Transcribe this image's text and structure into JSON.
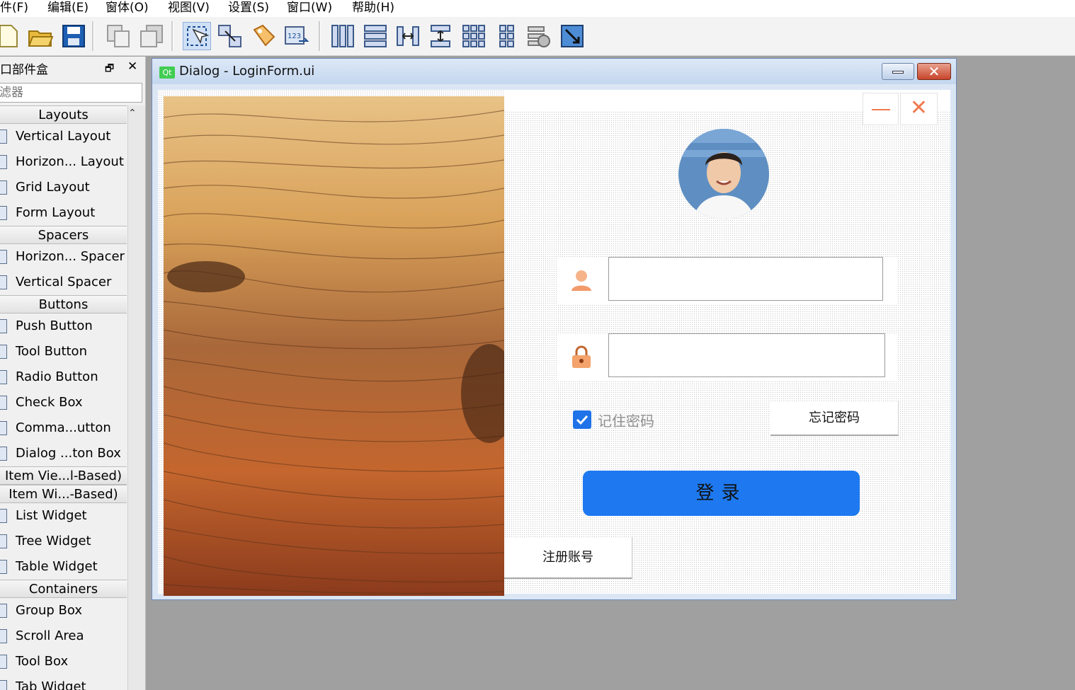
{
  "menu": [
    "件(F)",
    "编辑(E)",
    "窗体(O)",
    "视图(V)",
    "设置(S)",
    "窗口(W)",
    "帮助(H)"
  ],
  "toolbar_icons": [
    "new-file-icon",
    "open-folder-icon",
    "save-icon",
    "copy-icon",
    "paste-icon",
    "edit-widgets-icon",
    "edit-signals-slots-icon",
    "edit-buddies-icon",
    "edit-tab-order-icon",
    "layout-horizontal-icon",
    "layout-vertical-icon",
    "layout-horizontal-splitter-icon",
    "layout-vertical-splitter-icon",
    "layout-grid-icon",
    "layout-form-icon",
    "break-layout-icon",
    "adjust-size-icon"
  ],
  "widget_box": {
    "title": "口部件盒",
    "filter_placeholder": "滤器",
    "sections": [
      {
        "category": "Layouts",
        "items": [
          "Vertical Layout",
          "Horizon... Layout",
          "Grid Layout",
          "Form Layout"
        ]
      },
      {
        "category": "Spacers",
        "items": [
          "Horizon... Spacer",
          "Vertical Spacer"
        ]
      },
      {
        "category": "Buttons",
        "items": [
          "Push Button",
          "Tool Button",
          "Radio Button",
          "Check Box",
          "Comma...utton",
          "Dialog ...ton Box"
        ]
      },
      {
        "category": "Item Vie...l-Based)",
        "items": []
      },
      {
        "category": "Item Wi...-Based)",
        "items": [
          "List Widget",
          "Tree Widget",
          "Table Widget"
        ]
      },
      {
        "category": "Containers",
        "items": [
          "Group Box",
          "Scroll Area",
          "Tool Box",
          "Tab Widget"
        ]
      }
    ]
  },
  "dialog": {
    "badge": "Qt",
    "title": "Dialog - LoginForm.ui",
    "close_glyph": "✕"
  },
  "login_form": {
    "close_glyph": "✕",
    "username_value": "",
    "password_value": "",
    "remember_label": "记住密码",
    "remember_checked": true,
    "forgot_label": "忘记密码",
    "login_label": "登录",
    "register_label": "注册账号",
    "accent_color": "#1e79f0",
    "window_button_color": "#f07a50"
  }
}
